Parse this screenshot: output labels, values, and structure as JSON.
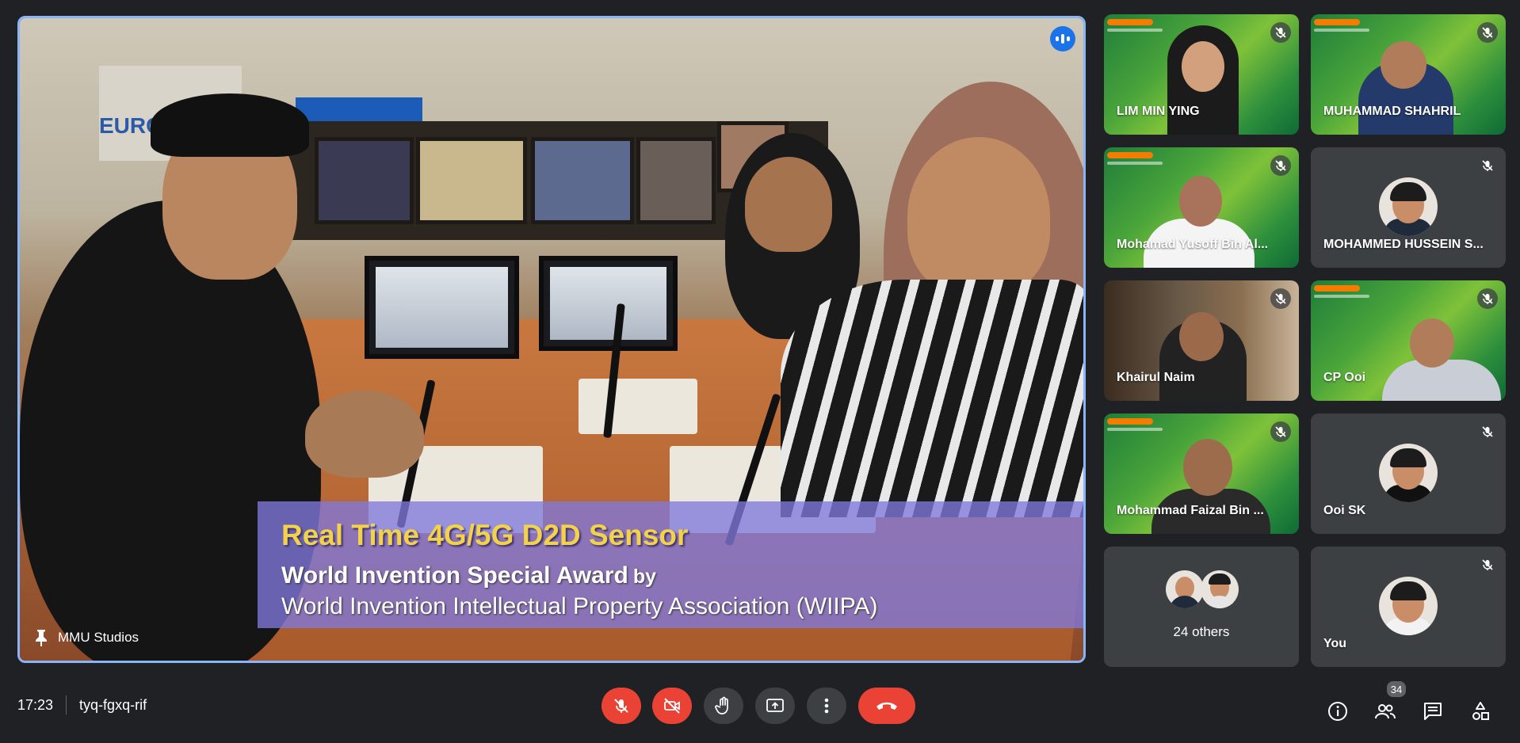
{
  "main_tile": {
    "presenter_name": "MMU Studios",
    "banner": {
      "title": "Real Time 4G/5G D2D Sensor",
      "award": "World Invention Special Award",
      "by": "by",
      "org": "World Invention Intellectual Property Association (WIIPA)"
    },
    "wall_sign": "EURO",
    "active_speaker_color": "#1a73e8",
    "border_color": "#8ab4f8"
  },
  "participants": [
    {
      "name": "LIM MIN YING",
      "muted": true,
      "background": "green-banner"
    },
    {
      "name": "MUHAMMAD SHAHRIL",
      "muted": true,
      "background": "green-banner"
    },
    {
      "name": "Mohamad Yusoff Bin Al...",
      "muted": true,
      "background": "green-banner"
    },
    {
      "name": "MOHAMMED HUSSEIN S...",
      "muted": true,
      "background": "avatar"
    },
    {
      "name": "Khairul Naim",
      "muted": true,
      "background": "office"
    },
    {
      "name": "CP Ooi",
      "muted": true,
      "background": "green-banner"
    },
    {
      "name": "Mohammad Faizal Bin ...",
      "muted": true,
      "background": "green-banner"
    },
    {
      "name": "Ooi SK",
      "muted": true,
      "background": "avatar"
    },
    {
      "name": "24 others",
      "muted": false,
      "background": "group"
    },
    {
      "name": "You",
      "muted": true,
      "background": "avatar"
    }
  ],
  "bottom_bar": {
    "time": "17:23",
    "meeting_code": "tyq-fgxq-rif",
    "controls": [
      "mic-off-icon",
      "camera-off-icon",
      "raise-hand-icon",
      "present-icon",
      "more-options-icon",
      "end-call-icon"
    ],
    "people_count": "34",
    "right_icons": [
      "info-icon",
      "people-icon",
      "chat-icon",
      "activities-icon"
    ]
  },
  "colors": {
    "background": "#202124",
    "tile": "#3c4043",
    "danger": "#ea4335"
  }
}
